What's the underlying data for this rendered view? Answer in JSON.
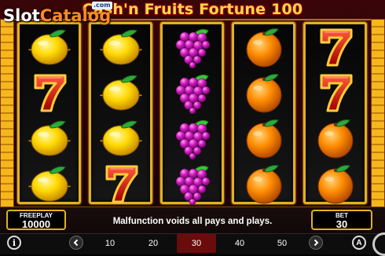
{
  "logo": {
    "slot": "Slot",
    "catalog": "Catalog",
    "dotcom": ".com"
  },
  "game": {
    "title": "Cash'n Fruits Fortune 100"
  },
  "reels": [
    [
      "lemon",
      "seven",
      "lemon",
      "lemon"
    ],
    [
      "lemon",
      "lemon",
      "lemon",
      "seven"
    ],
    [
      "grapes",
      "grapes",
      "grapes",
      "grapes"
    ],
    [
      "orange",
      "orange",
      "orange",
      "orange"
    ],
    [
      "seven",
      "seven",
      "orange",
      "orange"
    ]
  ],
  "freeplay": {
    "label": "FREEPLAY",
    "value": "10000"
  },
  "bet": {
    "label": "BET",
    "value": "30"
  },
  "message": "Malfunction voids all pays and plays.",
  "bet_options": [
    "10",
    "20",
    "30",
    "40",
    "50"
  ],
  "selected_bet": "30",
  "buttons": {
    "info": "i",
    "autoplay": "A"
  },
  "icons": {
    "info": "info-icon",
    "prev": "chevron-left-icon",
    "next": "chevron-right-icon",
    "auto": "autoplay-icon"
  },
  "colors": {
    "reel_border": "#e3b021",
    "title": "#ffd84a",
    "selected_bet_bg": "#6a0c0c"
  }
}
